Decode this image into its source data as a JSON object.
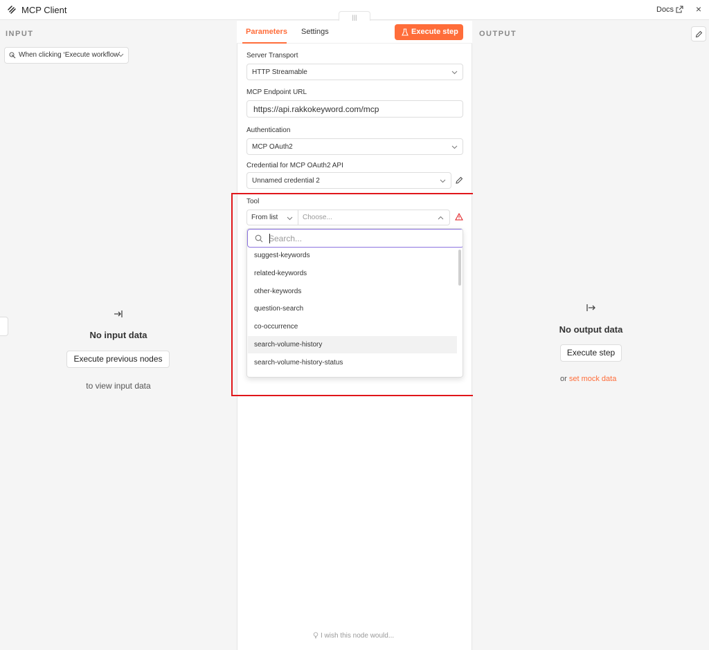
{
  "header": {
    "title": "MCP Client",
    "docs_label": "Docs",
    "close_glyph": "×"
  },
  "input_panel": {
    "label": "INPUT",
    "trigger": "When clicking ‘Execute workflow’",
    "empty_title": "No input data",
    "button": "Execute previous nodes",
    "hint": "to view input data"
  },
  "center": {
    "drag_glyph": "|||",
    "tabs": [
      {
        "label": "Parameters",
        "active": true
      },
      {
        "label": "Settings",
        "active": false
      }
    ],
    "execute_label": "Execute step",
    "fields": {
      "transport_label": "Server Transport",
      "transport_value": "HTTP Streamable",
      "endpoint_label": "MCP Endpoint URL",
      "endpoint_value": "https://api.rakkokeyword.com/mcp",
      "auth_label": "Authentication",
      "auth_value": "MCP OAuth2",
      "credential_label": "Credential for MCP OAuth2 API",
      "credential_value": "Unnamed credential 2",
      "tool_label": "Tool",
      "tool_mode": "From list",
      "tool_placeholder": "Choose..."
    },
    "dropdown": {
      "search_placeholder": "Search...",
      "options": [
        "suggest-keywords",
        "related-keywords",
        "other-keywords",
        "question-search",
        "co-occurrence",
        "search-volume-history",
        "search-volume-history-status"
      ],
      "highlighted_index": 5
    },
    "wish": "I wish this node would..."
  },
  "output_panel": {
    "label": "OUTPUT",
    "empty_title": "No output data",
    "button": "Execute step",
    "mock_prefix": "or",
    "mock_link": "set mock data"
  },
  "colors": {
    "accent": "#ff6d3a",
    "focus": "#8b73e0",
    "highlight_frame": "#e0161a"
  }
}
